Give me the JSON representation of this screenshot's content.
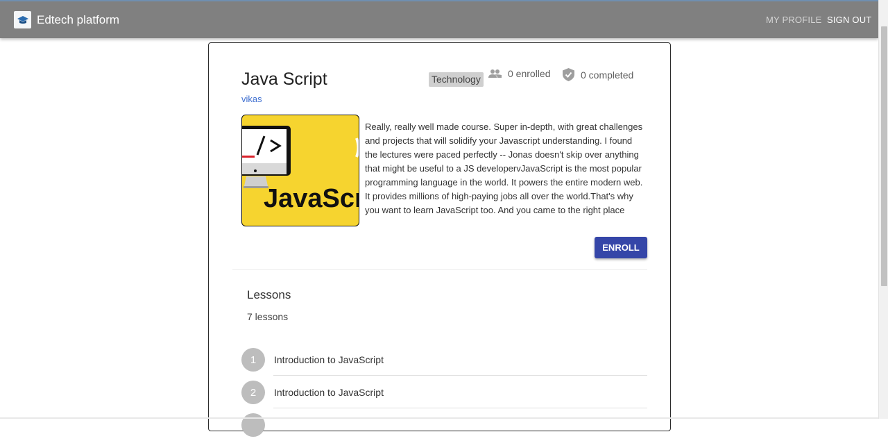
{
  "header": {
    "brand": "Edtech platform",
    "logo_icon": "graduation-cap-icon",
    "nav": {
      "profile": "MY PROFILE",
      "signout": "SIGN OUT"
    }
  },
  "course": {
    "title": "Java Script",
    "instructor": "vikas",
    "category": "Technology",
    "enrolled": "0 enrolled",
    "completed": "0 completed",
    "thumbnail_text": "JavaScr",
    "description": "Really, really well made course. Super in-depth, with great challenges and projects that will solidify your Javascript understanding. I found the lectures were paced perfectly -- Jonas doesn't skip over anything that might be useful to a JS developervJavaScript is the most popular programming language in the world. It powers the entire modern web. It provides millions of high-paying jobs all over the world.That's why you want to learn JavaScript too. And you came to the right place",
    "enroll_label": "ENROLL"
  },
  "lessons": {
    "title": "Lessons",
    "count": "7 lessons",
    "items": [
      {
        "num": "1",
        "title": "Introduction to JavaScript"
      },
      {
        "num": "2",
        "title": "Introduction to JavaScript"
      }
    ]
  },
  "colors": {
    "appbar": "#808080",
    "primary_button": "#3546a8",
    "link": "#3f6fd0",
    "thumbnail_bg": "#f6d42f"
  }
}
